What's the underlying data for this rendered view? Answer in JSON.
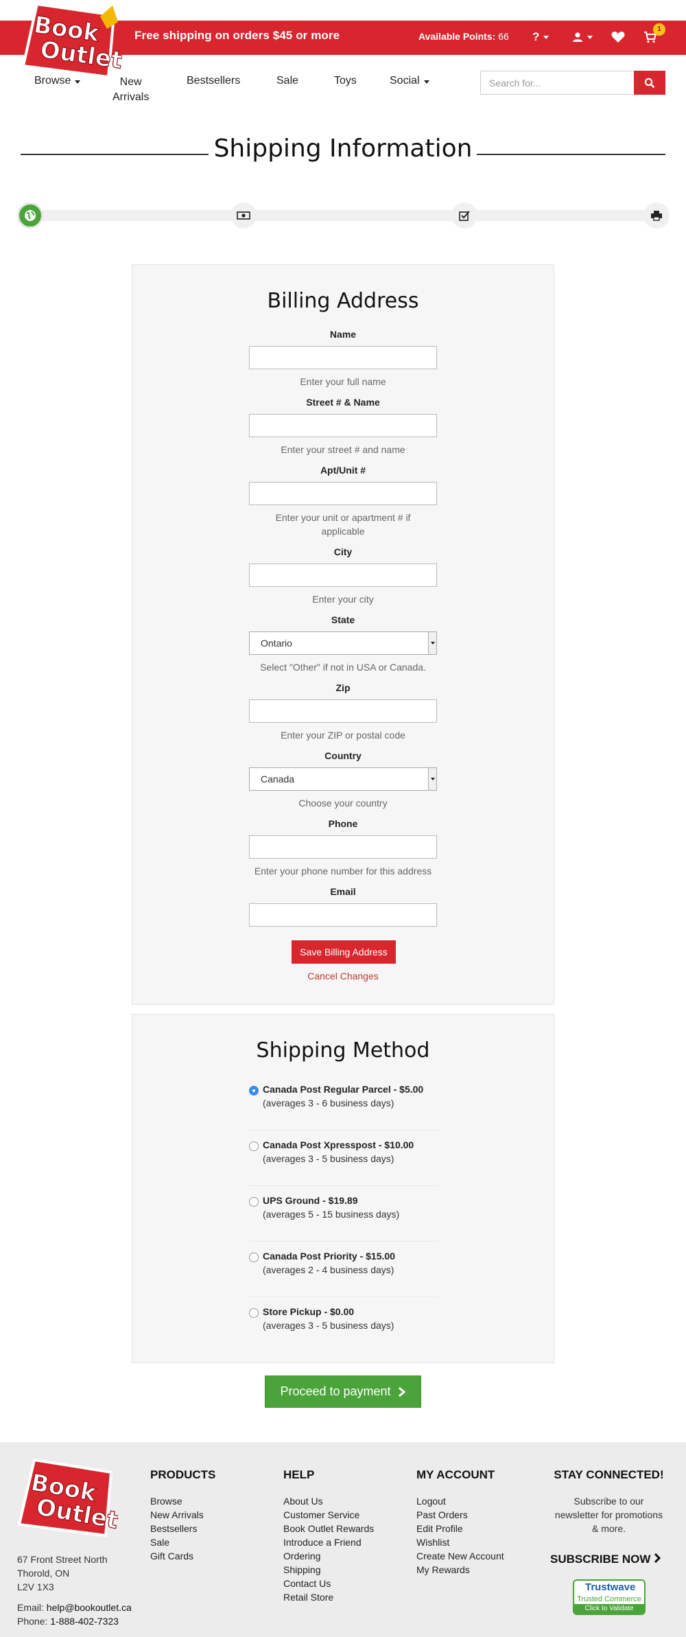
{
  "brand": {
    "logo_line1": "Book",
    "logo_line2": "Outlet",
    "color": "#d8262f"
  },
  "topbar": {
    "promo": "Free shipping on orders $45 or more",
    "points_label": "Available Points:",
    "points_value": "66",
    "help_icon": "question-mark",
    "cart_count": "1"
  },
  "nav": {
    "browse": "Browse",
    "new_line1": "New",
    "new_line2": "Arrivals",
    "bestsellers": "Bestsellers",
    "sale": "Sale",
    "toys": "Toys",
    "social": "Social",
    "search_placeholder": "Search for..."
  },
  "page": {
    "title": "Shipping Information"
  },
  "progress": {
    "steps": [
      "globe-icon",
      "money-icon",
      "check-square-icon",
      "print-icon"
    ],
    "active_step": 1
  },
  "billing": {
    "title": "Billing Address",
    "name_label": "Name",
    "name_help": "Enter your full name",
    "street_label": "Street # & Name",
    "street_help": "Enter your street # and name",
    "apt_label": "Apt/Unit #",
    "apt_help_line1": "Enter your unit or apartment # if",
    "apt_help_line2": "applicable",
    "city_label": "City",
    "city_help": "Enter your city",
    "state_label": "State",
    "state_value": "Ontario",
    "state_help": "Select \"Other\" if not in USA or Canada.",
    "zip_label": "Zip",
    "zip_help": "Enter your ZIP or postal code",
    "country_label": "Country",
    "country_value": "Canada",
    "country_help": "Choose your country",
    "phone_label": "Phone",
    "phone_help": "Enter your phone number for this address",
    "email_label": "Email",
    "save_label": "Save Billing Address",
    "cancel_label": "Cancel Changes"
  },
  "shipping": {
    "title": "Shipping Method",
    "options": [
      {
        "name": "Canada Post Regular Parcel - $5.00",
        "detail": "(averages 3 - 6 business days)",
        "selected": true
      },
      {
        "name": "Canada Post Xpresspost - $10.00",
        "detail": "(averages 3 - 5 business days)",
        "selected": false
      },
      {
        "name": "UPS Ground - $19.89",
        "detail": "(averages 5 - 15 business days)",
        "selected": false
      },
      {
        "name": "Canada Post Priority - $15.00",
        "detail": "(averages 2 - 4 business days)",
        "selected": false
      },
      {
        "name": "Store Pickup - $0.00",
        "detail": "(averages 3 - 5 business days)",
        "selected": false
      }
    ]
  },
  "proceed_label": "Proceed to payment",
  "footer": {
    "address_line1": "67 Front Street North",
    "address_line2": "Thorold, ON",
    "address_line3": "L2V 1X3",
    "email_label": "Email:",
    "email_value": "help@bookoutlet.ca",
    "phone_label": "Phone:",
    "phone_value": "1-888-402-7323",
    "products": {
      "title": "PRODUCTS",
      "links": [
        "Browse",
        "New Arrivals",
        "Bestsellers",
        "Sale",
        "Gift Cards"
      ]
    },
    "help": {
      "title": "HELP",
      "links": [
        "About Us",
        "Customer Service",
        "Book Outlet Rewards",
        "Introduce a Friend",
        "Ordering",
        "Shipping",
        "Contact Us",
        "Retail Store"
      ]
    },
    "account": {
      "title": "MY ACCOUNT",
      "links": [
        "Logout",
        "Past Orders",
        "Edit Profile",
        "Wishlist",
        "Create New Account",
        "My Rewards"
      ]
    },
    "stay": {
      "title": "STAY CONNECTED!",
      "text_line1": "Subscribe to our",
      "text_line2": "newsletter for promotions",
      "text_line3": "& more.",
      "subscribe": "SUBSCRIBE NOW"
    },
    "trust": {
      "line1": "Trustwave",
      "line2": "Trusted Commerce",
      "line3": "Click to Validate"
    }
  }
}
